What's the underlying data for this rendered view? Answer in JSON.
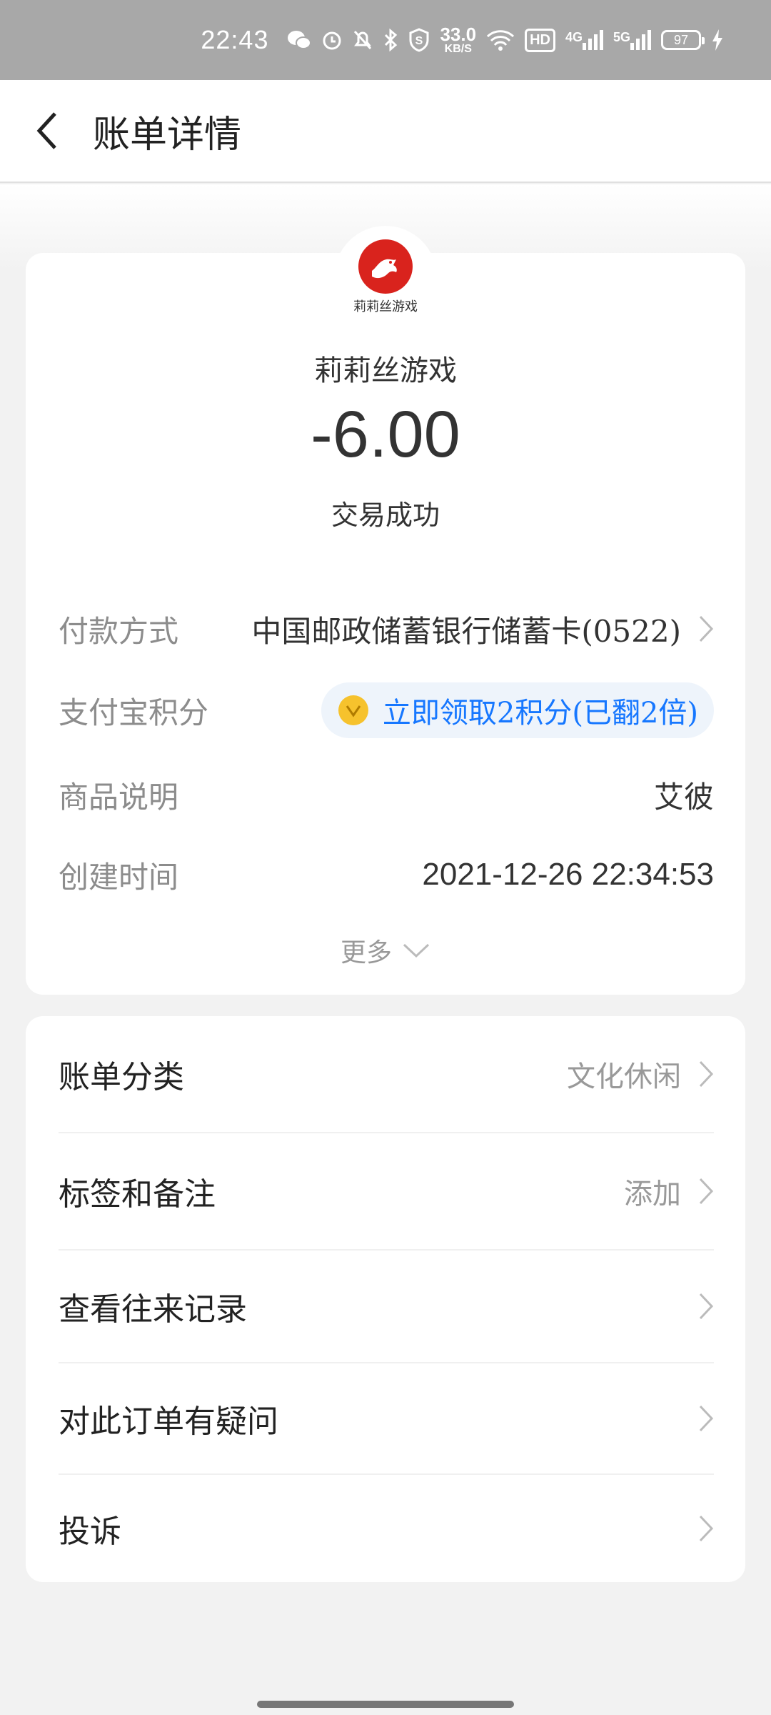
{
  "status_bar": {
    "time": "22:43",
    "speed_value": "33.0",
    "speed_unit": "KB/S",
    "hd_label": "HD",
    "net1": "4G",
    "net2": "5G",
    "battery": "97"
  },
  "header": {
    "title": "账单详情"
  },
  "bill": {
    "logo_text": "莉莉丝游戏",
    "merchant": "莉莉丝游戏",
    "amount": "-6.00",
    "status": "交易成功",
    "payment_label": "付款方式",
    "payment_value": "中国邮政储蓄银行储蓄卡(0522)",
    "points_label": "支付宝积分",
    "points_value": "立即领取2积分(已翻2倍)",
    "product_label": "商品说明",
    "product_value": "艾彼",
    "created_label": "创建时间",
    "created_value": "2021-12-26 22:34:53",
    "more_label": "更多"
  },
  "menu": {
    "category_label": "账单分类",
    "category_value": "文化休闲",
    "tags_label": "标签和备注",
    "tags_value": "添加",
    "records_label": "查看往来记录",
    "question_label": "对此订单有疑问",
    "complaint_label": "投诉"
  },
  "colors": {
    "accent": "#1677ff",
    "logo_red": "#d9231d",
    "coin": "#f6c22d"
  }
}
